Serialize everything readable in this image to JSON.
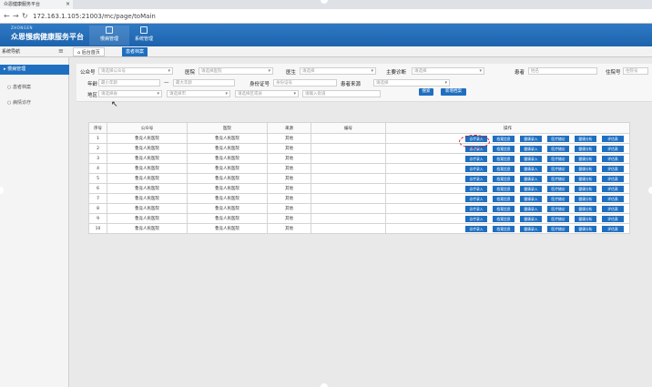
{
  "browser": {
    "tab_title": "众恩健康服务平台",
    "url": "172.163.1.105:21003/mc/page/toMain"
  },
  "header": {
    "logo_small": "ZHONGEN",
    "logo_main": "众恩慢病健康服务平台",
    "nav": [
      {
        "label": "慢病管理"
      },
      {
        "label": "系统管理"
      }
    ]
  },
  "secondary": {
    "sys_nav": "系统导航",
    "home_tab": "后台首页",
    "patient_tab": "患者档案"
  },
  "sidebar": {
    "group": "慢病管理",
    "items": [
      {
        "label": "患者档案"
      },
      {
        "label": "病情诊疗"
      }
    ]
  },
  "filters": {
    "company_label": "公众号",
    "company_placeholder": "请选择公众号",
    "hospital_label": "医院",
    "hospital_placeholder": "请选择医院",
    "doctor_label": "医生",
    "doctor_placeholder": "请选择",
    "diagnosis_label": "主要诊断",
    "diagnosis_placeholder": "请选择",
    "patient_label": "患者",
    "patient_placeholder": "姓名",
    "insurance_label": "住院号",
    "insurance_placeholder": "住院号",
    "age_label": "年龄",
    "age_min_placeholder": "最小年龄",
    "age_sep": "—",
    "age_max_placeholder": "最大年龄",
    "idcard_label": "身份证号",
    "idcard_placeholder": "身份证号",
    "source_label": "患者来源",
    "source_placeholder": "请选择",
    "region_label": "地区",
    "province_placeholder": "请选择省",
    "city_placeholder": "请选择市",
    "district_placeholder": "请选择区或县",
    "street_placeholder": "请输入街道",
    "search_button": "搜索",
    "add_button": "新增档案"
  },
  "table": {
    "headers": [
      "序号",
      "公众号",
      "医院",
      "来源",
      "编号",
      "操作"
    ],
    "op_labels": [
      "诊疗录入",
      "档案信息",
      "健康录入",
      "医疗随访",
      "健康分析",
      "评估表"
    ],
    "rows": [
      {
        "no": "1",
        "company": "鲁竞人民医院",
        "hospital": "鲁竞人民医院",
        "source": "其他",
        "code": ""
      },
      {
        "no": "2",
        "company": "鲁竞人民医院",
        "hospital": "鲁竞人民医院",
        "source": "其他",
        "code": ""
      },
      {
        "no": "3",
        "company": "鲁竞人民医院",
        "hospital": "鲁竞人民医院",
        "source": "其他",
        "code": ""
      },
      {
        "no": "4",
        "company": "鲁竞人民医院",
        "hospital": "鲁竞人民医院",
        "source": "其他",
        "code": ""
      },
      {
        "no": "5",
        "company": "鲁竞人民医院",
        "hospital": "鲁竞人民医院",
        "source": "其他",
        "code": ""
      },
      {
        "no": "6",
        "company": "鲁竞人民医院",
        "hospital": "鲁竞人民医院",
        "source": "其他",
        "code": ""
      },
      {
        "no": "7",
        "company": "鲁竞人民医院",
        "hospital": "鲁竞人民医院",
        "source": "其他",
        "code": ""
      },
      {
        "no": "8",
        "company": "鲁竞人民医院",
        "hospital": "鲁竞人民医院",
        "source": "其他",
        "code": ""
      },
      {
        "no": "9",
        "company": "鲁竞人民医院",
        "hospital": "鲁竞人民医院",
        "source": "其他",
        "code": ""
      },
      {
        "no": "10",
        "company": "鲁竞人民医院",
        "hospital": "鲁竞人民医院",
        "source": "其他",
        "code": ""
      }
    ]
  },
  "colors": {
    "brand_blue": "#1f6fc0",
    "highlight_red": "#d8182c"
  }
}
